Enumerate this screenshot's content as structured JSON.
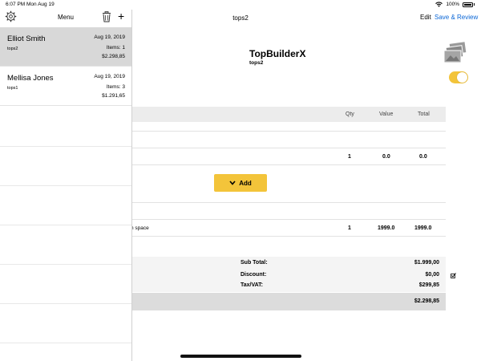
{
  "status": {
    "time": "6:07 PM",
    "date": "Mon Aug 19",
    "battery": "100%"
  },
  "nav": {
    "title": "tops2",
    "edit": "Edit",
    "save_review": "Save & Review"
  },
  "business": {
    "name": "TopBuilderX",
    "sub": "tops2"
  },
  "table": {
    "headers": {
      "qty": "Qty",
      "value": "Value",
      "total": "Total"
    },
    "row1": {
      "qty": "1",
      "value": "0.0",
      "total": "0.0"
    },
    "row2": {
      "desc_fragment": "n space",
      "qty": "1",
      "value": "1999.0",
      "total": "1999.0"
    }
  },
  "add_button": {
    "label": "Add"
  },
  "summary": {
    "subtotal_label": "Sub Total:",
    "subtotal": "$1.999,00",
    "discount_label": "Discount:",
    "discount": "$0,00",
    "tax_label": "Tax/VAT:",
    "tax": "$299,85",
    "total": "$2.298,85"
  },
  "sidebar": {
    "title": "Menu",
    "items": [
      {
        "name": "Elliot Smith",
        "sub": "tops2",
        "date": "Aug 19, 2019",
        "items": "Items: 1",
        "amount": "$2.298,85",
        "selected": true
      },
      {
        "name": "Mellisa Jones",
        "sub": "tops1",
        "date": "Aug 19, 2019",
        "items": "Items: 3",
        "amount": "$1.291,65",
        "selected": false
      }
    ]
  },
  "colors": {
    "accent": "#f3c43a",
    "link": "#0a66d6",
    "selected_row": "#d8d8d8"
  }
}
